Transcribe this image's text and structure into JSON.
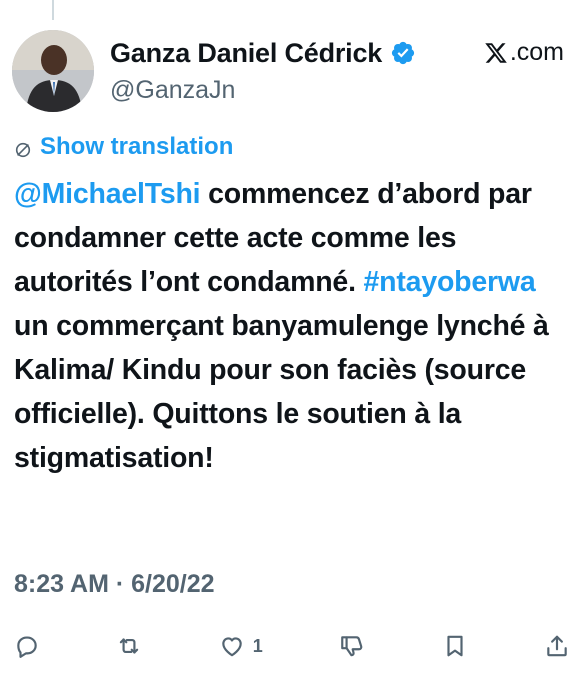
{
  "author": {
    "display_name": "Ganza Daniel Cédrick",
    "handle": "@GanzaJn",
    "verified": true,
    "verified_color": "#1d9bf0"
  },
  "source": {
    "site": ".com",
    "logo_icon": "x-logo-icon"
  },
  "translation": {
    "label": "Show translation",
    "icon": "globe-icon"
  },
  "tweet": {
    "mention": "@MichaelTshi",
    "text_part1": " commencez d’abord par condamner cette acte comme les autorités l’ont condamné. ",
    "hashtag": "#ntayoberwa",
    "text_part2": " un commerçant banyamulenge lynché à Kalima/ Kindu pour son faciès (source officielle). Quittons le soutien à la stigmatisation!",
    "link_color": "#1d9bf0"
  },
  "meta": {
    "timestamp": "8:23 AM · 6/20/22"
  },
  "actions": {
    "reply_icon": "reply-icon",
    "retweet_icon": "retweet-icon",
    "like_icon": "heart-icon",
    "like_count": "1",
    "dislike_icon": "thumbs-down-icon",
    "bookmark_icon": "bookmark-icon",
    "share_icon": "share-icon"
  }
}
